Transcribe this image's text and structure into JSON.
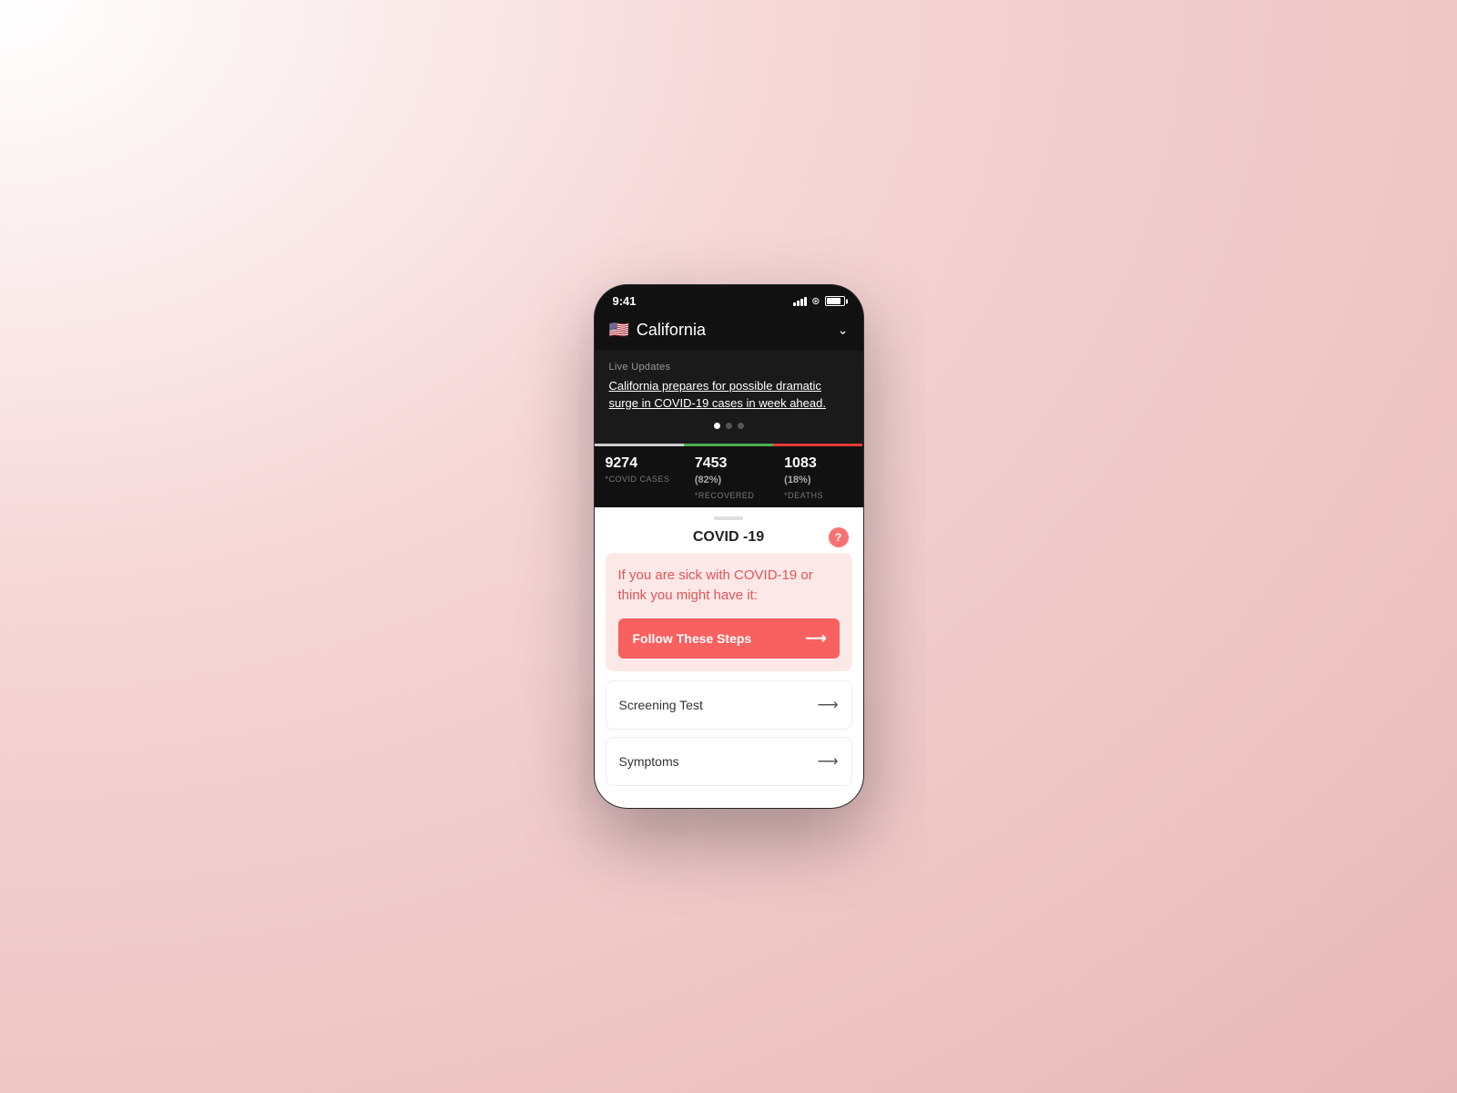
{
  "statusBar": {
    "time": "9:41"
  },
  "header": {
    "flag": "🇺🇸",
    "location": "California",
    "chevron": "∨"
  },
  "newsBanner": {
    "liveLabel": "Live Updates",
    "headline": "California prepares for possible dramatic surge in COVID-19 cases in week ahead.",
    "dots": [
      {
        "active": true
      },
      {
        "active": false
      },
      {
        "active": false
      }
    ]
  },
  "stats": {
    "cases": {
      "value": "9274",
      "pct": "",
      "label": "*COVID CASES"
    },
    "recovered": {
      "value": "7453",
      "pct": "(82%)",
      "label": "*RECOVERED"
    },
    "deaths": {
      "value": "1083",
      "pct": "(18%)",
      "label": "*DEATHS"
    }
  },
  "sheet": {
    "title": "COVID -19",
    "helpIcon": "?",
    "infoText": "If you are sick with COVID-19 or think you might have it:",
    "followButton": "Follow These Steps",
    "screeningItem": "Screening Test",
    "symptomsItem": "Symptoms"
  }
}
